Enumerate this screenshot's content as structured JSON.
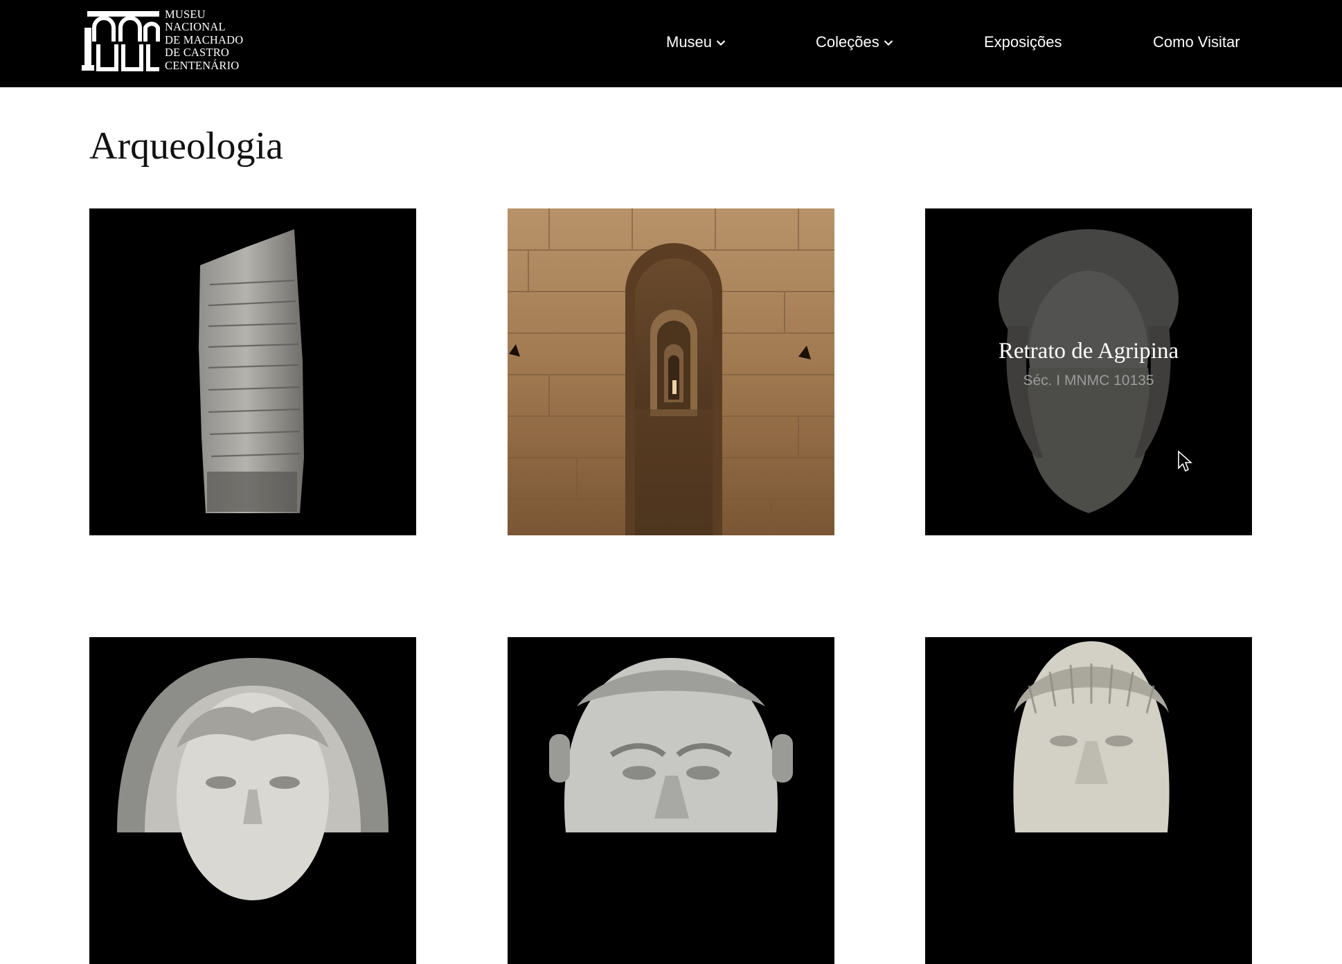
{
  "header": {
    "logo": {
      "lines": [
        "MUSEU",
        "NACIONAL",
        "DE MACHADO",
        "DE CASTRO",
        "CENTENÁRIO"
      ],
      "mark": "100-arches-logo"
    },
    "nav": [
      {
        "label": "Museu",
        "has_dropdown": true
      },
      {
        "label": "Coleções",
        "has_dropdown": true
      },
      {
        "label": "Exposições",
        "has_dropdown": false
      },
      {
        "label": "Como Visitar",
        "has_dropdown": false
      }
    ]
  },
  "page": {
    "title": "Arqueologia"
  },
  "collection": {
    "items": [
      {
        "image": "roman-milestone-inscription",
        "title": "",
        "meta": ""
      },
      {
        "image": "cryptoporticus-arched-corridor",
        "title": "",
        "meta": ""
      },
      {
        "image": "bust-of-agrippina",
        "title": "Retrato de Agripina",
        "meta": "Séc. I MNMC 10135",
        "hovered": true
      },
      {
        "image": "veiled-female-marble-head",
        "title": "",
        "meta": ""
      },
      {
        "image": "male-marble-portrait-head",
        "title": "",
        "meta": ""
      },
      {
        "image": "roman-emperor-marble-head",
        "title": "",
        "meta": ""
      }
    ]
  },
  "colors": {
    "header_bg": "#000000",
    "header_text": "#ffffff",
    "page_bg": "#ffffff",
    "title_text": "#111111",
    "card_bg": "#000000",
    "caption_meta": "#9c9c9c",
    "stone_wall": "#a9835a"
  },
  "icons": {
    "dropdown": "chevron-down-icon",
    "cursor": "mouse-pointer-icon"
  }
}
